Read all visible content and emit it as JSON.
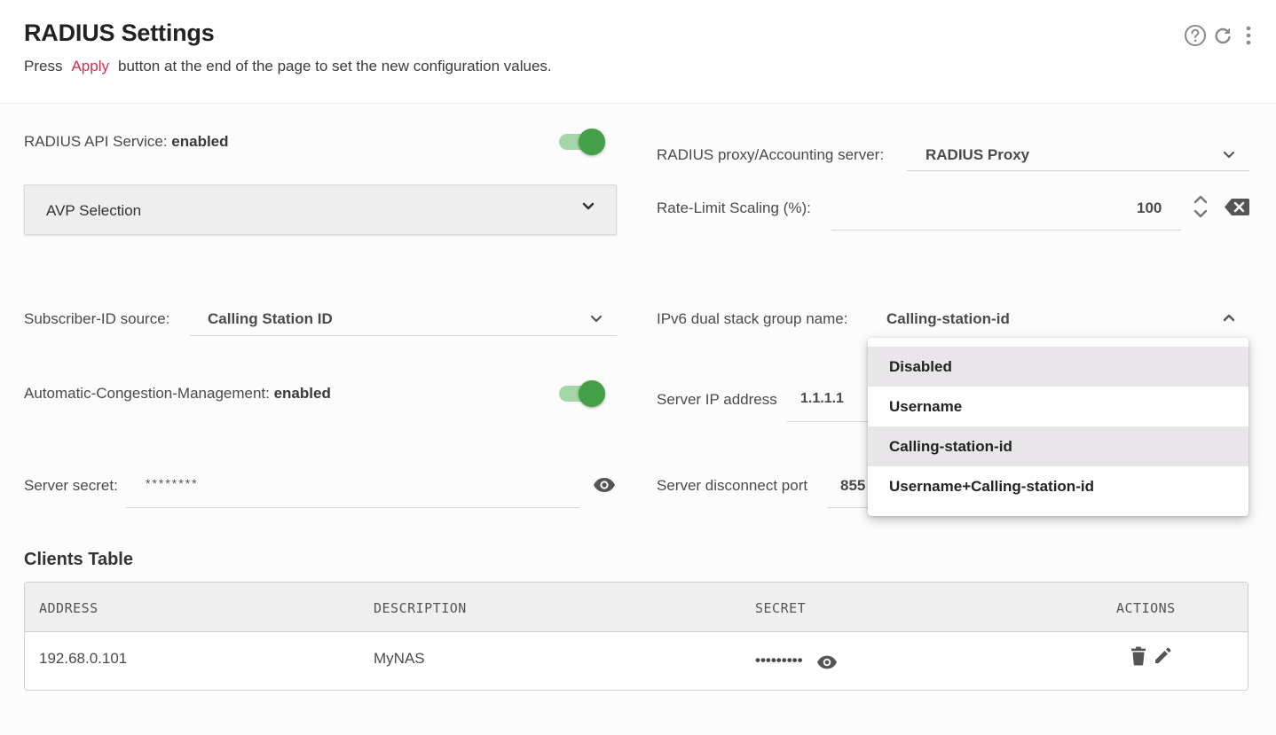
{
  "header": {
    "title": "RADIUS Settings",
    "subtitle_prefix": "Press",
    "subtitle_apply": "Apply",
    "subtitle_suffix": "button at the end of the page to set the new configuration values.",
    "icons": [
      "help-icon",
      "refresh-icon",
      "more-vert-icon"
    ]
  },
  "left": {
    "api_service": {
      "label": "RADIUS API Service: ",
      "state": "enabled",
      "on": true
    },
    "avp_selection": {
      "label": "AVP Selection"
    },
    "subscriber_id": {
      "label": "Subscriber-ID source:",
      "value": "Calling Station ID"
    },
    "congestion": {
      "label": "Automatic-Congestion-Management: ",
      "state": "enabled",
      "on": true
    },
    "server_secret": {
      "label": "Server secret:",
      "value": "********"
    }
  },
  "right": {
    "proxy": {
      "label": "RADIUS proxy/Accounting server:",
      "value": "RADIUS Proxy"
    },
    "rate_limit": {
      "label": "Rate-Limit Scaling (%):",
      "value": "100"
    },
    "ipv6_group": {
      "label": "IPv6 dual stack group name:",
      "value": "Calling-station-id"
    },
    "server_ip": {
      "label": "Server IP address",
      "value": "1.1.1.1"
    },
    "disconnect_port": {
      "label": "Server disconnect port",
      "value": "855"
    }
  },
  "ipv6_menu": {
    "options": [
      "Disabled",
      "Username",
      "Calling-station-id",
      "Username+Calling-station-id"
    ],
    "selected": "Calling-station-id"
  },
  "clients_table": {
    "title": "Clients Table",
    "columns": [
      "ADDRESS",
      "DESCRIPTION",
      "SECRET",
      "ACTIONS"
    ],
    "rows": [
      {
        "address": "192.68.0.101",
        "description": "MyNAS",
        "secret": "•••••••••"
      }
    ]
  },
  "colors": {
    "accent": "#d62d4e",
    "toggle_on": "#43a047",
    "toggle_track": "#a5d6a7"
  }
}
